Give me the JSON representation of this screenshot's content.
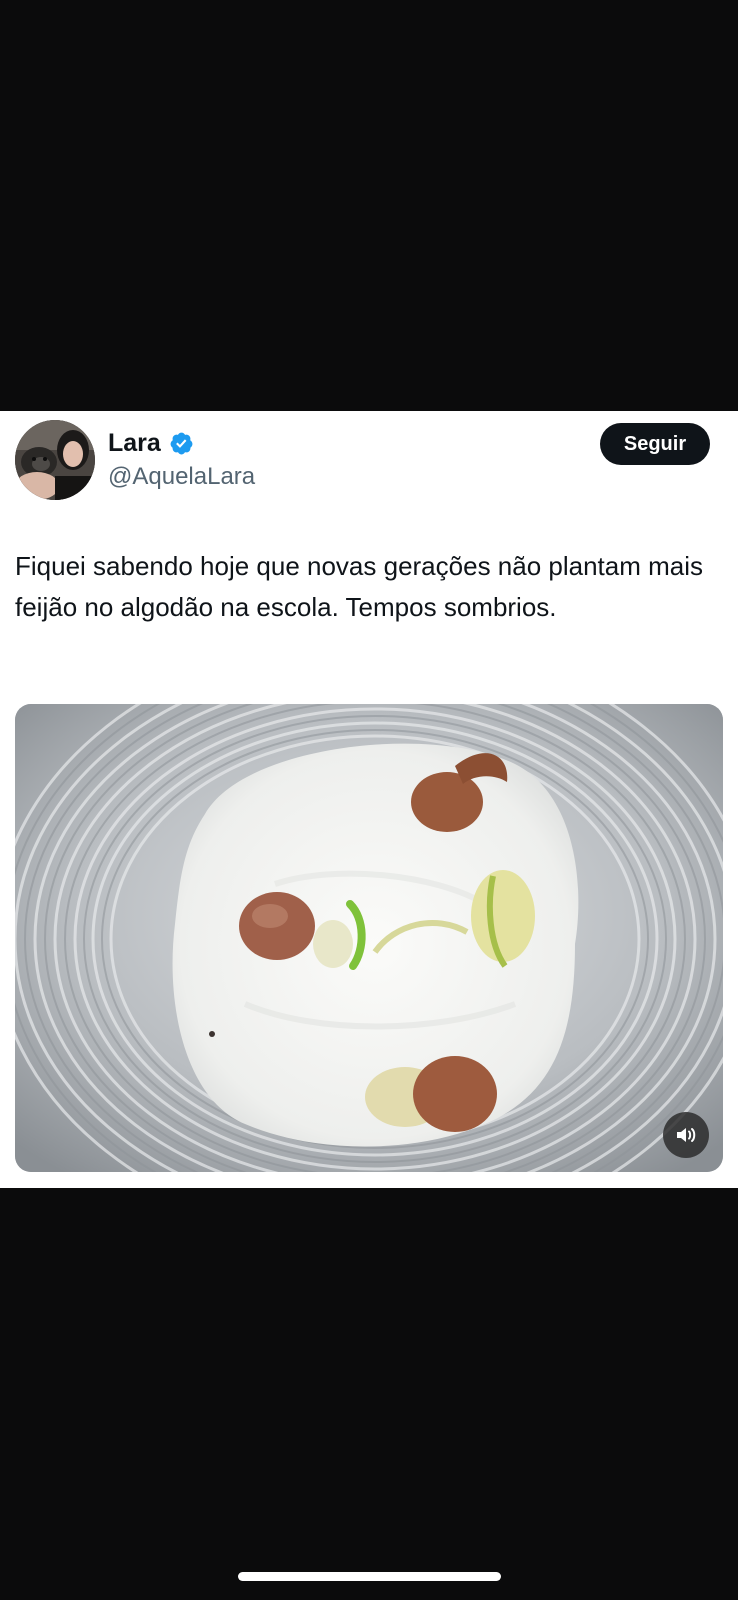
{
  "tweet": {
    "author": {
      "display_name": "Lara",
      "handle": "@AquelaLara",
      "verified": true
    },
    "follow_label": "Seguir",
    "text": "Fiquei sabendo hoje que novas gerações não plantam mais feijão no algodão na escola. Tempos sombrios.",
    "media": {
      "type": "video",
      "controls": [
        "volume-icon"
      ]
    }
  },
  "colors": {
    "background": "#0b0b0c",
    "card": "#ffffff",
    "text": "#0f1419",
    "secondary_text": "#536471",
    "verified": "#1d9bf0",
    "follow_button": "#0f1419"
  }
}
